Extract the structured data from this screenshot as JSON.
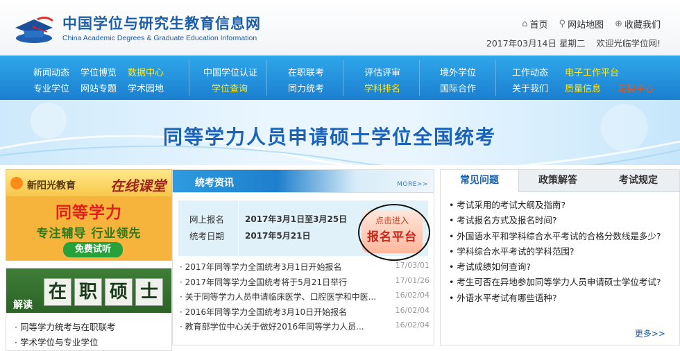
{
  "header": {
    "title": "中国学位与研究生教育信息网",
    "subtitle": "China Academic Degrees & Graduate Education Information",
    "links": [
      {
        "icon": "home-icon",
        "glyph": "⌂",
        "label": "首页"
      },
      {
        "icon": "map-pin-icon",
        "glyph": "⚲",
        "label": "网站地图"
      },
      {
        "icon": "bookmark-icon",
        "glyph": "⊕",
        "label": "收藏我们"
      }
    ],
    "date": "2017年03月14日 星期二",
    "welcome": "欢迎光临学位网!"
  },
  "nav": {
    "g1": {
      "r1": [
        "新闻动态",
        "学位博览",
        "数据中心"
      ],
      "r2": [
        "专业学位",
        "网站专题",
        "学术园地"
      ]
    },
    "g2": {
      "r1": "中国学位认证",
      "r2": "学位查询"
    },
    "g3": {
      "r1": "在职联考",
      "r2": "同力统考"
    },
    "g4": {
      "r1": "评估评审",
      "r2": "学科排名"
    },
    "g5": {
      "r1": "境外学位",
      "r2": "国际合作"
    },
    "g6": {
      "r1": [
        "工作动态",
        "电子工作平台"
      ],
      "r2": [
        "关于我们",
        "质量信息",
        "定製中心"
      ]
    }
  },
  "banner": {
    "title": "同等学力人员申请硕士学位全国统考"
  },
  "left_ad": {
    "brand": "新阳光教育",
    "cls": "在线课堂",
    "main": "同等学力",
    "sub": "专注辅导 行业领先",
    "btn": "免费试听"
  },
  "left_box": {
    "read": "解读",
    "title": [
      "在",
      "职",
      "硕",
      "士"
    ],
    "links": [
      "· 同等学力统考与在职联考",
      "· 学术学位与专业学位"
    ]
  },
  "exam_info": {
    "title": "统考资讯",
    "more": "MORE>>",
    "reg_label": "网上报名",
    "reg_value": "2017年3月1日至3月25日",
    "exam_label": "统考日期",
    "exam_value": "2017年5月21日",
    "cta_small": "点击进入",
    "cta_big": "报名平台",
    "news": [
      {
        "title": "· 2017年同等学力全国统考3月1日开始报名",
        "date": "17/03/01"
      },
      {
        "title": "· 2017年同等学力全国统考将于5月21日举行",
        "date": "17/01/26"
      },
      {
        "title": "· 关于同等学力人员申请临床医学、口腔医学和中医...",
        "date": "16/02/04"
      },
      {
        "title": "· 2016年同等学力全国统考3月10日开始报名",
        "date": "16/02/04"
      },
      {
        "title": "· 教育部学位中心关于做好2016年同等学力人员...",
        "date": "16/02/04"
      }
    ]
  },
  "faq_panel": {
    "tabs": [
      "常见问题",
      "政策解答",
      "考试规定"
    ],
    "items": [
      "考试采用的考试大纲及指南?",
      "考试报名方式及报名时间?",
      "外国语水平和学科综合水平考试的合格分数线是多少?",
      "学科综合水平考试的学科范围?",
      "考试成绩如何查询?",
      "考生可否在异地参加同等学力人员申请硕士学位考试?",
      "外语水平考试有哪些语种?"
    ],
    "more": "更多>>"
  }
}
